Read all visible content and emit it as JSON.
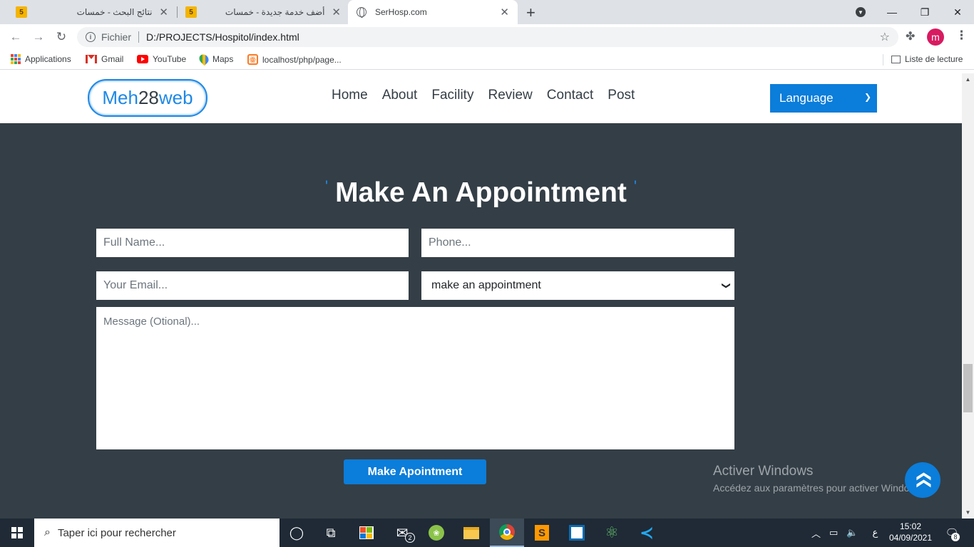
{
  "browser": {
    "tabs": [
      {
        "title": "نتائج البحث - خمسات",
        "favicon": "5"
      },
      {
        "title": "أضف خدمة جديدة - خمسات",
        "favicon": "5"
      },
      {
        "title": "SerHosp.com",
        "favicon": "globe-icon"
      }
    ],
    "address": {
      "scheme": "Fichier",
      "url": "D:/PROJECTS/Hospitol/index.html"
    },
    "profile_initial": "m",
    "bookmarks": [
      {
        "label": "Applications",
        "icon": "apps-grid-icon"
      },
      {
        "label": "Gmail",
        "icon": "gmail-icon"
      },
      {
        "label": "YouTube",
        "icon": "youtube-icon"
      },
      {
        "label": "Maps",
        "icon": "maps-icon"
      },
      {
        "label": "localhost/php/page...",
        "icon": "xampp-icon"
      }
    ],
    "reading_list": "Liste de lecture"
  },
  "site": {
    "logo": {
      "part1": "Meh",
      "part2": "28",
      "part3": "web"
    },
    "nav": [
      "Home",
      "About",
      "Facility",
      "Review",
      "Contact",
      "Post"
    ],
    "language_select": "Language",
    "appointment": {
      "title": "Make An Appointment",
      "tick": "'",
      "full_name_placeholder": "Full Name...",
      "phone_placeholder": "Phone...",
      "email_placeholder": "Your Email...",
      "select_value": "make an appointment",
      "message_placeholder": "Message (Otional)...",
      "submit_label": "Make Apointment"
    },
    "activation": {
      "title": "Activer Windows",
      "subtitle": "Accédez aux paramètres pour activer Windows."
    }
  },
  "taskbar": {
    "search_placeholder": "Taper ici pour rechercher",
    "mail_badge": "2",
    "language_indicator": "ع",
    "time": "15:02",
    "date": "04/09/2021",
    "notification_count": "8"
  },
  "colors": {
    "brand_blue": "#0b7dda",
    "section_bg": "#343e46",
    "taskbar_bg": "#1f2a36"
  }
}
